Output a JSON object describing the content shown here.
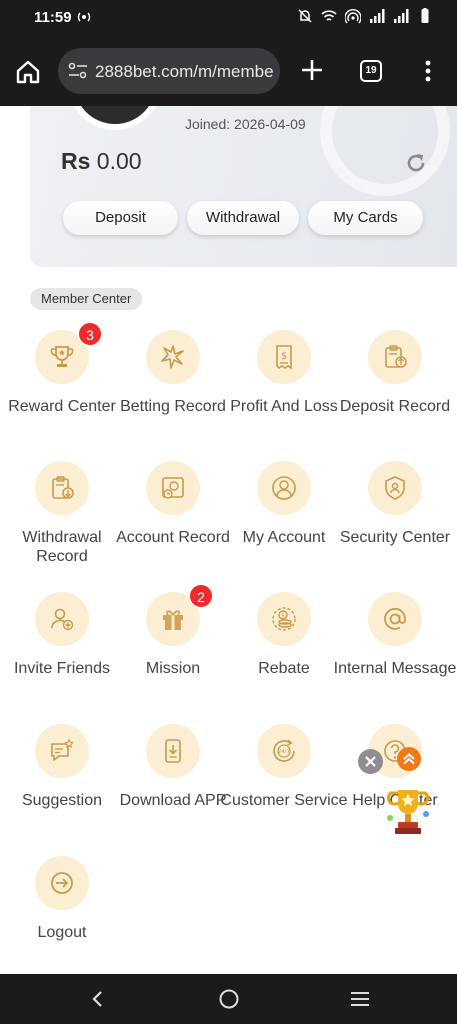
{
  "status_bar": {
    "time": "11:59",
    "icons": [
      "radio-icon",
      "mute-icon",
      "wifi-icon",
      "hotspot-icon",
      "signal-icon",
      "signal-icon",
      "battery-icon"
    ]
  },
  "browser": {
    "url": "2888bet.com/m/membe",
    "tab_count": "19"
  },
  "profile": {
    "joined": "Joined: 2026-04-09",
    "currency": "Rs",
    "balance": "0.00",
    "buttons": {
      "deposit": "Deposit",
      "withdrawal": "Withdrawal",
      "my_cards": "My Cards"
    }
  },
  "member_center": {
    "title": "Member Center",
    "items": [
      {
        "label": "Reward Center",
        "badge": "3",
        "icon": "trophy-icon"
      },
      {
        "label": "Betting Record",
        "icon": "star-ball-icon"
      },
      {
        "label": "Profit And Loss",
        "icon": "receipt-icon"
      },
      {
        "label": "Deposit Record",
        "icon": "clipboard-upload-icon"
      },
      {
        "label": "Withdrawal Record",
        "icon": "clipboard-download-icon"
      },
      {
        "label": "Account Record",
        "icon": "safe-clock-icon"
      },
      {
        "label": "My Account",
        "icon": "user-icon"
      },
      {
        "label": "Security Center",
        "icon": "shield-user-icon"
      },
      {
        "label": "Invite Friends",
        "icon": "add-user-icon"
      },
      {
        "label": "Mission",
        "badge": "2",
        "icon": "gift-icon"
      },
      {
        "label": "Rebate",
        "icon": "coins-icon"
      },
      {
        "label": "Internal Message",
        "icon": "at-sign-icon"
      },
      {
        "label": "Suggestion",
        "icon": "chat-star-icon"
      },
      {
        "label": "Download APP",
        "icon": "phone-download-icon"
      },
      {
        "label": "Customer Service",
        "icon": "support-24-7-icon"
      },
      {
        "label": "Help Center",
        "icon": "help-icon"
      },
      {
        "label": "Logout",
        "icon": "logout-icon"
      }
    ]
  },
  "colors": {
    "accent": "#c89a4c",
    "icon_bg": "#fbeed3",
    "badge": "#ee2a2a",
    "float_up": "#f07a16"
  }
}
